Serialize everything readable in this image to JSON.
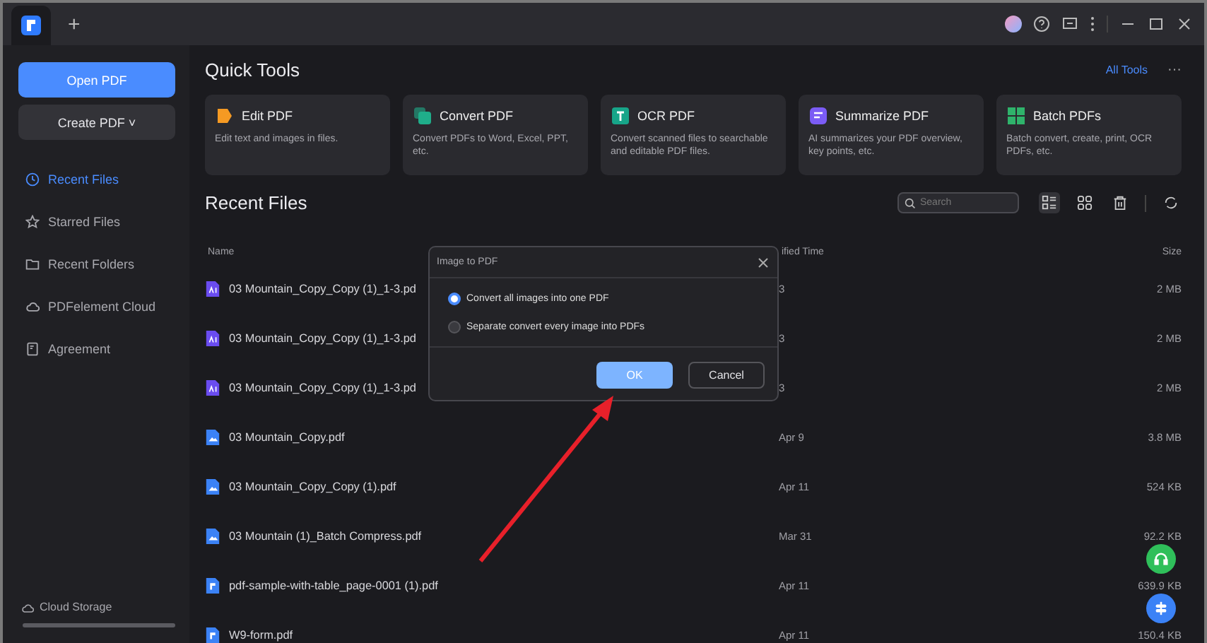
{
  "titlebar": {
    "new_tab": "+"
  },
  "sidebar": {
    "open_button": "Open PDF",
    "create_button": "Create PDF",
    "create_caret": "˅",
    "items": [
      {
        "label": "Recent Files",
        "selected": true
      },
      {
        "label": "Starred Files",
        "selected": false
      },
      {
        "label": "Recent Folders",
        "selected": false
      },
      {
        "label": "PDFelement Cloud",
        "selected": false
      },
      {
        "label": "Agreement",
        "selected": false
      }
    ],
    "footer": "Cloud Storage"
  },
  "quick_tools": {
    "title": "Quick Tools",
    "all_tools": "All Tools",
    "more": "···",
    "tools": [
      {
        "title": "Edit PDF",
        "description": "Edit text and images in files.",
        "color": "#f59a23"
      },
      {
        "title": "Convert PDF",
        "description": "Convert PDFs to Word, Excel, PPT, etc.",
        "color": "#1fae8a"
      },
      {
        "title": "OCR PDF",
        "description": "Convert scanned files to searchable and editable PDF files.",
        "color": "#17a589"
      },
      {
        "title": "Summarize PDF",
        "description": "AI summarizes your PDF overview, key points, etc.",
        "color": "#7b5cf5"
      },
      {
        "title": "Batch PDFs",
        "description": "Batch convert, create, print, OCR PDFs, etc.",
        "color": "#2fb36b"
      }
    ]
  },
  "recent": {
    "title": "Recent Files",
    "search": {
      "placeholder": "Search"
    },
    "columns": [
      "Name",
      "ified Time",
      "Size"
    ],
    "rows": [
      {
        "kind": "ai",
        "name": "03 Mountain_Copy_Copy (1)_1-3.pd",
        "date": "3",
        "size": "2 MB"
      },
      {
        "kind": "ai",
        "name": "03 Mountain_Copy_Copy (1)_1-3.pd",
        "date": "3",
        "size": "2 MB"
      },
      {
        "kind": "ai",
        "name": "03 Mountain_Copy_Copy (1)_1-3.pd",
        "date": "3",
        "size": "2 MB"
      },
      {
        "kind": "image",
        "name": "03 Mountain_Copy.pdf",
        "date": "Apr 9",
        "size": "3.8 MB"
      },
      {
        "kind": "image",
        "name": "03 Mountain_Copy_Copy (1).pdf",
        "date": "Apr 11",
        "size": "524 KB"
      },
      {
        "kind": "image",
        "name": "03 Mountain (1)_Batch Compress.pdf",
        "date": "Mar 31",
        "size": "92.2 KB"
      },
      {
        "kind": "pdf",
        "name": "pdf-sample-with-table_page-0001 (1).pdf",
        "date": "Apr 11",
        "size": "639.9 KB"
      },
      {
        "kind": "pdf",
        "name": "W9-form.pdf",
        "date": "Apr 11",
        "size": "150.4 KB"
      }
    ]
  },
  "dialog": {
    "title": "Image to PDF",
    "options": [
      {
        "label": "Convert all images into one PDF",
        "selected": true
      },
      {
        "label": "Separate convert every image into PDFs",
        "selected": false
      }
    ],
    "ok": "OK",
    "cancel": "Cancel"
  }
}
